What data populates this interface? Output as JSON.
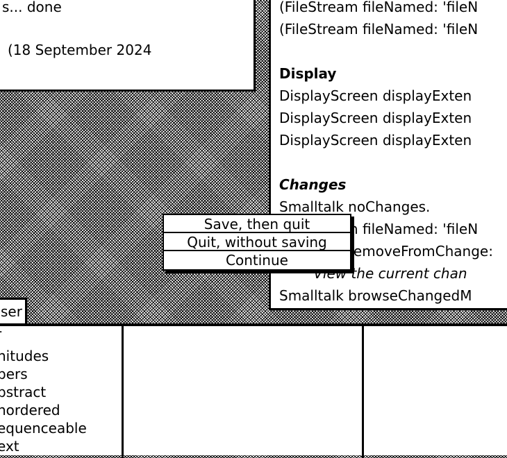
{
  "transcript": {
    "line1": "s... done",
    "line2": "(18 September 2024"
  },
  "workspace": {
    "file_line1": "(FileStream fileNamed: 'fileN",
    "file_line2": "(FileStream fileNamed: 'fileN",
    "display_heading": "Display",
    "display_line1": "DisplayScreen displayExten",
    "display_line2": "DisplayScreen displayExten",
    "display_line3": "DisplayScreen displayExten",
    "changes_heading": "Changes",
    "changes_line1": "Smalltalk noChanges.",
    "changes_line2": "(FileStream fileNamed: 'fileN",
    "changes_line3": "Smalltalk removeFromChange:",
    "changes_line4_italic": "\"View the current chan",
    "changes_line5": "Smalltalk browseChangedM"
  },
  "browser": {
    "label": "ser",
    "categories": [
      "-",
      "nitudes",
      "bers",
      "bstract",
      "nordered",
      "equenceable",
      "ext"
    ]
  },
  "quit_menu": {
    "items": [
      "Save, then quit",
      "Quit, without saving",
      "Continue"
    ]
  }
}
